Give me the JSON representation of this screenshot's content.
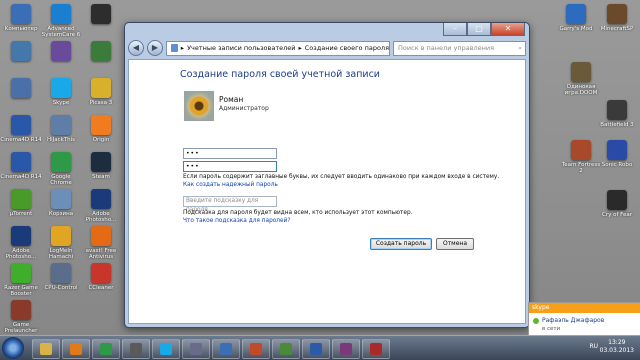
{
  "desktop": {
    "icons": [
      {
        "label": "Компьютер",
        "color": "#3a6fb5"
      },
      {
        "label": "Advanced SystemCare 6",
        "color": "#1a7fd0"
      },
      {
        "label": "",
        "color": "#2d2d2d"
      },
      {
        "label": "",
        "color": "#4477aa"
      },
      {
        "label": "",
        "color": "#6a4a9a"
      },
      {
        "label": "",
        "color": "#3b7b3b"
      },
      {
        "label": "",
        "color": "#4b6fa8"
      },
      {
        "label": "Skype",
        "color": "#19a9e8"
      },
      {
        "label": "Picasa 3",
        "color": "#d8b02a"
      },
      {
        "label": "Cinema4D R14",
        "color": "#2b57a8"
      },
      {
        "label": "HiJackThis",
        "color": "#5e7da8"
      },
      {
        "label": "Origin",
        "color": "#f07c1f"
      },
      {
        "label": "Cinema4D R14",
        "color": "#2b57a8"
      },
      {
        "label": "Google Chrome",
        "color": "#2e9a48"
      },
      {
        "label": "Steam",
        "color": "#1c2d3f"
      },
      {
        "label": "µTorrent",
        "color": "#4a9a2a"
      },
      {
        "label": "Корзина",
        "color": "#6b8fb8"
      },
      {
        "label": "Adobe Photosho...",
        "color": "#1b3a7a"
      },
      {
        "label": "Adobe Photosho...",
        "color": "#1b3a7a"
      },
      {
        "label": "LogMeIn Hamachi",
        "color": "#e0a623"
      },
      {
        "label": "avast! Free Antivirus",
        "color": "#e56a15"
      },
      {
        "label": "Razer Game Booster",
        "color": "#3fae2a"
      },
      {
        "label": "CPU-Control",
        "color": "#5a6d8a"
      },
      {
        "label": "CCleaner",
        "color": "#c8352a"
      },
      {
        "label": "Game Prelauncher",
        "color": "#8a3a2a"
      }
    ],
    "right_icons": [
      {
        "label": "Garry's Mod",
        "color": "#2c6bc0"
      },
      {
        "label": "MinecraftSP",
        "color": "#6a4a2a"
      },
      {
        "label": "Одинокая игра DOOM",
        "color": "#6a5a3a"
      },
      {
        "label": "Battlefield 3",
        "color": "#3a3a3a"
      },
      {
        "label": "Team Fortress 2",
        "color": "#a84a2a"
      },
      {
        "label": "Sonic Robo",
        "color": "#2a4aa8"
      },
      {
        "label": "Cry of Fear",
        "color": "#2a2a2a"
      }
    ]
  },
  "window": {
    "title": "",
    "controls": {
      "minimize": "–",
      "maximize": "□",
      "close": "✕"
    },
    "breadcrumb": [
      "Учетные записи пользователей",
      "Создание своего пароля"
    ],
    "search_placeholder": "Поиск в панели управления"
  },
  "dialog": {
    "heading": "Создание пароля своей учетной записи",
    "user_name": "Роман",
    "user_role": "Администратор",
    "password_masked": "•••",
    "confirm_masked": "•••",
    "case_note": "Если пароль содержит заглавные буквы, их следует вводить одинаково при каждом входе в систему.",
    "strong_password_link": "Как создать надежный пароль",
    "hint_placeholder": "Введите подсказку для пароля",
    "hint_note": "Подсказка для пароля будет видна всем, кто использует этот компьютер.",
    "hint_link": "Что такое подсказка для паролей?",
    "create_button": "Создать пароль",
    "cancel_button": "Отмена"
  },
  "taskbar": {
    "items": [
      {
        "name": "explorer",
        "color": "#d9b24a"
      },
      {
        "name": "media-player",
        "color": "#e07a1a"
      },
      {
        "name": "chrome",
        "color": "#2e9a48"
      },
      {
        "name": "app",
        "color": "#5a5a5a"
      },
      {
        "name": "skype",
        "color": "#19a9e8"
      },
      {
        "name": "app",
        "color": "#6a6a8a"
      },
      {
        "name": "app",
        "color": "#3a6fb5"
      },
      {
        "name": "app",
        "color": "#c04a2a"
      },
      {
        "name": "app",
        "color": "#4a8a3a"
      },
      {
        "name": "app",
        "color": "#2a5aa8"
      },
      {
        "name": "app",
        "color": "#7a3a7a"
      },
      {
        "name": "app",
        "color": "#a82a2a"
      }
    ],
    "lang": "RU",
    "time": "13:29",
    "date": "03.03.2013"
  },
  "notification": {
    "app": "skype",
    "contact": "Рафаэль Джафаров",
    "status": "в сети"
  }
}
